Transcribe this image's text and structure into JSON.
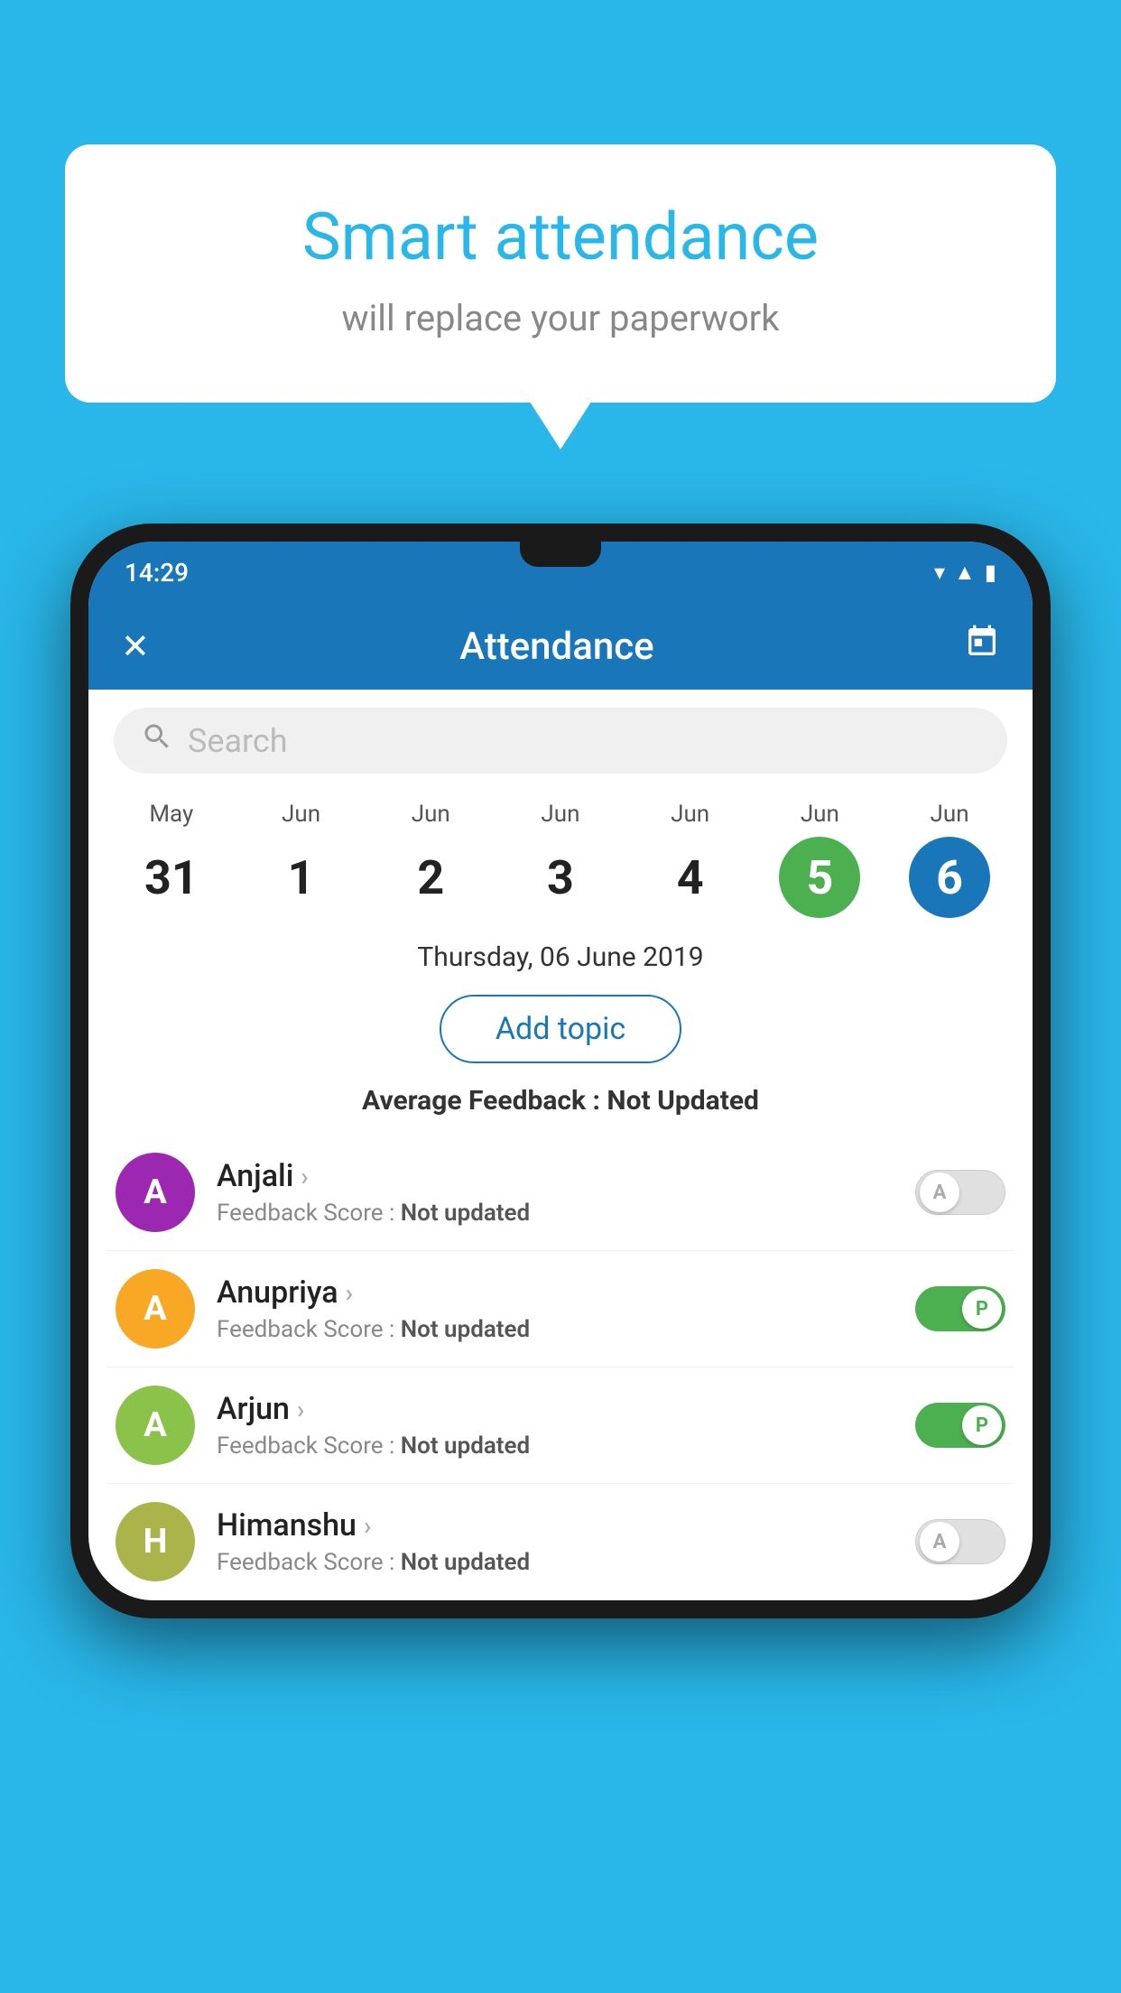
{
  "background_color": "#29b6e8",
  "speech_bubble": {
    "title": "Smart attendance",
    "subtitle": "will replace your paperwork"
  },
  "status_bar": {
    "time": "14:29",
    "icons": [
      "wifi",
      "signal",
      "battery"
    ]
  },
  "app_bar": {
    "title": "Attendance",
    "close_icon": "✕",
    "calendar_icon": "📅"
  },
  "search": {
    "placeholder": "Search"
  },
  "calendar": {
    "days": [
      {
        "month": "May",
        "date": "31",
        "style": "normal"
      },
      {
        "month": "Jun",
        "date": "1",
        "style": "normal"
      },
      {
        "month": "Jun",
        "date": "2",
        "style": "normal"
      },
      {
        "month": "Jun",
        "date": "3",
        "style": "normal"
      },
      {
        "month": "Jun",
        "date": "4",
        "style": "normal"
      },
      {
        "month": "Jun",
        "date": "5",
        "style": "today"
      },
      {
        "month": "Jun",
        "date": "6",
        "style": "selected"
      }
    ]
  },
  "selected_date": "Thursday, 06 June 2019",
  "add_topic_label": "Add topic",
  "avg_feedback_label": "Average Feedback :",
  "avg_feedback_value": "Not Updated",
  "students": [
    {
      "name": "Anjali",
      "avatar_letter": "A",
      "avatar_color": "#9c27b0",
      "feedback_label": "Feedback Score :",
      "feedback_value": "Not updated",
      "toggle": "off",
      "toggle_letter": "A"
    },
    {
      "name": "Anupriya",
      "avatar_letter": "A",
      "avatar_color": "#f9a825",
      "feedback_label": "Feedback Score :",
      "feedback_value": "Not updated",
      "toggle": "on",
      "toggle_letter": "P"
    },
    {
      "name": "Arjun",
      "avatar_letter": "A",
      "avatar_color": "#8bc34a",
      "feedback_label": "Feedback Score :",
      "feedback_value": "Not updated",
      "toggle": "on",
      "toggle_letter": "P"
    },
    {
      "name": "Himanshu",
      "avatar_letter": "H",
      "avatar_color": "#aab44a",
      "feedback_label": "Feedback Score :",
      "feedback_value": "Not updated",
      "toggle": "off",
      "toggle_letter": "A"
    }
  ]
}
